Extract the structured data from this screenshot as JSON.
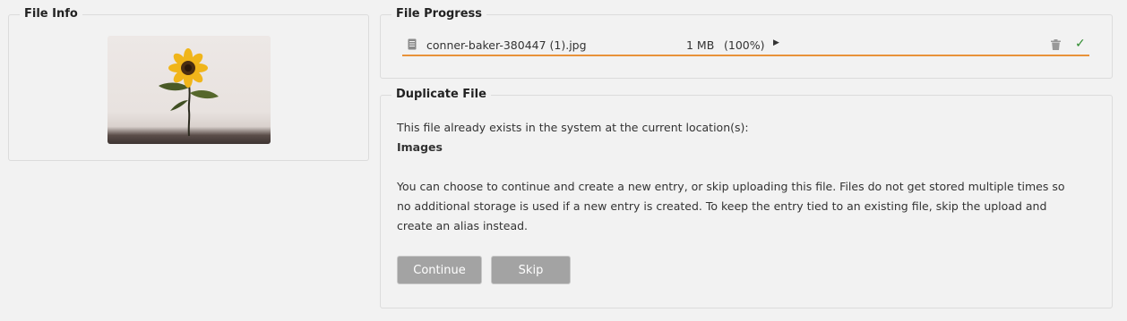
{
  "file_info": {
    "legend": "File Info",
    "thumbnail": {
      "icon": "sunflower-image"
    }
  },
  "file_progress": {
    "legend": "File Progress",
    "filename": "conner-baker-380447 (1).jpg",
    "size": "1 MB",
    "percent_label": "(100%)",
    "progress": 1.0,
    "colors": {
      "progress_fill": "#e8923a",
      "success": "#2e8b2e"
    },
    "icons": [
      "file-icon",
      "play-icon",
      "trash-icon",
      "check-icon"
    ]
  },
  "duplicate_file": {
    "legend": "Duplicate File",
    "intro": "This file already exists in the system at the current location(s):",
    "location": "Images",
    "explanation": [
      "You can choose to continue and create a new entry, or skip uploading this file. Files do not get stored multiple times so",
      "no additional storage is used if a new entry is created. To keep the entry tied to an existing file, skip the upload and",
      "create an alias instead."
    ],
    "buttons": {
      "continue": "Continue",
      "skip": "Skip"
    }
  }
}
